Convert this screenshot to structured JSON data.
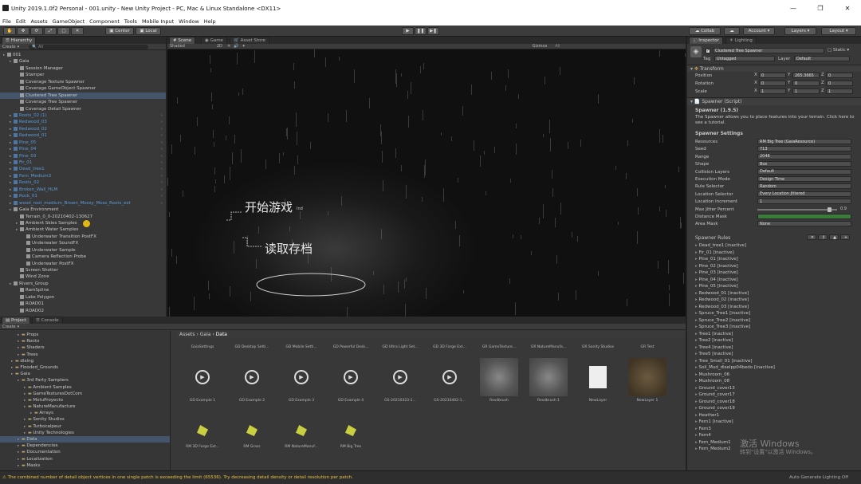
{
  "window": {
    "title": "Unity 2019.1.0f2 Personal - 001.unity - New Unity Project - PC, Mac & Linux Standalone <DX11>",
    "min": "—",
    "max": "❐",
    "close": "✕"
  },
  "menu": [
    "File",
    "Edit",
    "Assets",
    "GameObject",
    "Component",
    "Tools",
    "Mobile Input",
    "Window",
    "Help"
  ],
  "toolbar": {
    "center": "Center",
    "local": "Local",
    "collab": "Collab",
    "account": "Account",
    "layers": "Layers",
    "layout": "Layout"
  },
  "hierarchy": {
    "tab": "Hierarchy",
    "create": "Create",
    "search": "All",
    "items": [
      {
        "t": "001",
        "d": 0,
        "c": ""
      },
      {
        "t": "Gaia",
        "d": 1,
        "c": ""
      },
      {
        "t": "Session Manager",
        "d": 2,
        "c": ""
      },
      {
        "t": "Stamper",
        "d": 2,
        "c": ""
      },
      {
        "t": "Coverage Texture Spawner",
        "d": 2,
        "c": ""
      },
      {
        "t": "Coverage GameObject Spawner",
        "d": 2,
        "c": ""
      },
      {
        "t": "Clustered Tree Spawner",
        "d": 2,
        "c": "sel"
      },
      {
        "t": "Coverage Tree Spawner",
        "d": 2,
        "c": ""
      },
      {
        "t": "Coverage Detail Spawner",
        "d": 2,
        "c": ""
      },
      {
        "t": "Roots_02 (1)",
        "d": 1,
        "c": "blue"
      },
      {
        "t": "Redwood_03",
        "d": 1,
        "c": "blue"
      },
      {
        "t": "Redwood_02",
        "d": 1,
        "c": "blue"
      },
      {
        "t": "Redwood_01",
        "d": 1,
        "c": "blue"
      },
      {
        "t": "Pine_05",
        "d": 1,
        "c": "blue"
      },
      {
        "t": "Pine_04",
        "d": 1,
        "c": "blue"
      },
      {
        "t": "Pine_03",
        "d": 1,
        "c": "blue"
      },
      {
        "t": "Fir_01",
        "d": 1,
        "c": "blue"
      },
      {
        "t": "Dead_tree1",
        "d": 1,
        "c": "blue"
      },
      {
        "t": "Fern_Medium3",
        "d": 1,
        "c": "blue"
      },
      {
        "t": "Roots_02",
        "d": 1,
        "c": "blue"
      },
      {
        "t": "Broken_Wall_HLM",
        "d": 1,
        "c": "blue"
      },
      {
        "t": "Rock_01",
        "d": 1,
        "c": "blue"
      },
      {
        "t": "wood_root_medium_Brown_Mossy_Moss_Roots_ext",
        "d": 1,
        "c": "blue"
      },
      {
        "t": "Gaia Environment",
        "d": 1,
        "c": ""
      },
      {
        "t": "Terrain_0_0-20210402-130627",
        "d": 2,
        "c": ""
      },
      {
        "t": "Ambient Skies Samples",
        "d": 2,
        "c": ""
      },
      {
        "t": "Ambient Water Samples",
        "d": 2,
        "c": ""
      },
      {
        "t": "Underwater Transition PostFX",
        "d": 3,
        "c": ""
      },
      {
        "t": "Underwater SoundFX",
        "d": 3,
        "c": ""
      },
      {
        "t": "Underwater Sample",
        "d": 3,
        "c": ""
      },
      {
        "t": "Camera Reflection Probe",
        "d": 3,
        "c": ""
      },
      {
        "t": "Underwater PostFX",
        "d": 3,
        "c": ""
      },
      {
        "t": "Screen Shotter",
        "d": 2,
        "c": ""
      },
      {
        "t": "Wind Zone",
        "d": 2,
        "c": ""
      },
      {
        "t": "Rivers_Group",
        "d": 1,
        "c": ""
      },
      {
        "t": "RamSpline",
        "d": 2,
        "c": ""
      },
      {
        "t": "Lake Polygon",
        "d": 2,
        "c": ""
      },
      {
        "t": "ROAD01",
        "d": 2,
        "c": ""
      },
      {
        "t": "ROAD02",
        "d": 2,
        "c": ""
      }
    ]
  },
  "scene": {
    "tab_scene": "Scene",
    "tab_game": "Game",
    "tab_asset": "Asset Store",
    "shaded": "Shaded",
    "mode": "2D",
    "gizmos": "Gizmos",
    "all": "All",
    "menu_start": "开始游戏",
    "menu_load": "读取存档",
    "tag_text": "Ind"
  },
  "project": {
    "tab": "Project",
    "console_tab": "Console",
    "create": "Create",
    "breadcrumb": [
      "Assets",
      "Gaia",
      "Data"
    ],
    "folders": [
      {
        "t": "Props",
        "d": 2
      },
      {
        "t": "Rocks",
        "d": 2
      },
      {
        "t": "Shaders",
        "d": 2
      },
      {
        "t": "Trees",
        "d": 2
      },
      {
        "t": "dixing",
        "d": 1
      },
      {
        "t": "Flooded_Grounds",
        "d": 1
      },
      {
        "t": "Gaia",
        "d": 1
      },
      {
        "t": "3rd Party Samplers",
        "d": 2
      },
      {
        "t": "Ambient Samples",
        "d": 3
      },
      {
        "t": "GameTexturesDotCom",
        "d": 3
      },
      {
        "t": "MotuProyecto",
        "d": 3
      },
      {
        "t": "NatureManufacture",
        "d": 3
      },
      {
        "t": "Arrays",
        "d": 4
      },
      {
        "t": "Sonity Studios",
        "d": 3
      },
      {
        "t": "Turbocalpeur",
        "d": 3
      },
      {
        "t": "Unity Technologies",
        "d": 3
      },
      {
        "t": "Data",
        "d": 2
      },
      {
        "t": "Dependencies",
        "d": 2
      },
      {
        "t": "Documentation",
        "d": 2
      },
      {
        "t": "Localization",
        "d": 2
      },
      {
        "t": "Masks",
        "d": 2
      }
    ],
    "row1_labels": [
      "GaiaSettings",
      "GD Desktop Setti...",
      "GD Mobile Setti...",
      "GD Powerful Desk...",
      "GD Ultra Light Set...",
      "GD 3D Forge Ext...",
      "GR GameTexture...",
      "GR NatureManufa...",
      "GR Sonity Studios",
      "GR Test"
    ],
    "row2_labels": [
      "GD Example 1",
      "GD Example 2",
      "GD Example 3",
      "GD Example 4",
      "GS-20210323-1...",
      "GS-20210402-1...",
      "Resdbrush",
      "Resdbrush 1",
      "NewLayer",
      "NewLayer 1"
    ],
    "row3_labels": [
      "RM 3D Forge Ext...",
      "RM Grass",
      "RM NatureManuf...",
      "RM Big Tree"
    ]
  },
  "inspector": {
    "tab": "Inspector",
    "lighting_tab": "Lighting",
    "object_name": "Clustered Tree Spawner",
    "static": "Static",
    "tag_label": "Tag",
    "tag_value": "Untagged",
    "layer_label": "Layer",
    "layer_value": "Default",
    "transform": "Transform",
    "position": {
      "label": "Position",
      "x": "0",
      "y": "265.3665",
      "z": "0"
    },
    "rotation": {
      "label": "Rotation",
      "x": "0",
      "y": "0",
      "z": "0"
    },
    "scale": {
      "label": "Scale",
      "x": "1",
      "y": "1",
      "z": "1"
    },
    "script_header": "Spawner (Script)",
    "spawner_version": "Spawner (1.9.5)",
    "description": "The Spawner allows you to place features into your terrain. Click here to see a tutorial.",
    "settings_header": "Spawner Settings",
    "settings": [
      {
        "k": "Resources",
        "v": "RM Big Tree (GaiaResource)"
      },
      {
        "k": "Seed",
        "v": "713"
      },
      {
        "k": "Range",
        "v": "2048"
      },
      {
        "k": "Shape",
        "v": "Box"
      },
      {
        "k": "Collision Layers",
        "v": "Default"
      },
      {
        "k": "Execution Mode",
        "v": "Design Time"
      },
      {
        "k": "Rule Selector",
        "v": "Random"
      },
      {
        "k": "Location Selector",
        "v": "Every Location Jittered"
      },
      {
        "k": "Location Increment",
        "v": "1"
      },
      {
        "k": "Max Jitter Percent",
        "v": "0.9"
      },
      {
        "k": "Distance Mask",
        "v": ""
      },
      {
        "k": "Area Mask",
        "v": "None"
      }
    ],
    "rules_header": "Spawner Rules",
    "rules": [
      "Dead_tree1 [inactive]",
      "Fir_01 [inactive]",
      "Pine_01 [inactive]",
      "Pine_02 [inactive]",
      "Pine_03 [inactive]",
      "Pine_04 [inactive]",
      "Pine_05 [inactive]",
      "Redwood_01 [inactive]",
      "Redwood_02 [inactive]",
      "Redwood_03 [inactive]",
      "Spruce_Tree1 [inactive]",
      "Spruce_Tree2 [inactive]",
      "Spruce_Tree3 [inactive]",
      "Tree1 [inactive]",
      "Tree2 [inactive]",
      "Tree4 [inactive]",
      "Tree5 [inactive]",
      "Tree_Small_01 [inactive]",
      "Soil_Mud_diselpp04bedo [inactive]",
      "Mushroom_06",
      "Mushroom_08",
      "Ground_cover13",
      "Ground_cover17",
      "Ground_cover18",
      "Ground_cover19",
      "Heather1",
      "Fern1 [inactive]",
      "Fern3",
      "Fern4",
      "Fern_Medium1",
      "Fern_Medium2"
    ],
    "watermark1": "激活 Windows",
    "watermark2": "转到\"设置\"以激活 Windows。"
  },
  "status": {
    "message": "The combined number of detail object vertices in one single patch is exceeding the limit (65536). Try decreasing detail density or detail resolution per patch.",
    "right": "Auto Generate Lighting Off"
  }
}
